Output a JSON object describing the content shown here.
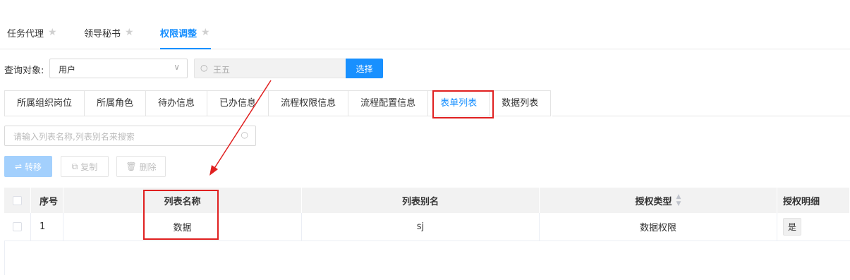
{
  "top_tabs": [
    {
      "label": "任务代理",
      "active": false
    },
    {
      "label": "领导秘书",
      "active": false
    },
    {
      "label": "权限调整",
      "active": true
    }
  ],
  "query": {
    "label": "查询对象:",
    "object_type": "用户",
    "search_placeholder": "王五",
    "select_button": "选择"
  },
  "sub_tabs": [
    {
      "label": "所属组织岗位",
      "active": false
    },
    {
      "label": "所属角色",
      "active": false
    },
    {
      "label": "待办信息",
      "active": false
    },
    {
      "label": "已办信息",
      "active": false
    },
    {
      "label": "流程权限信息",
      "active": false
    },
    {
      "label": "流程配置信息",
      "active": false
    },
    {
      "label": "表单列表",
      "active": true
    },
    {
      "label": "数据列表",
      "active": false
    }
  ],
  "list_search": {
    "placeholder": "请输入列表名称,列表别名来搜索"
  },
  "actions": {
    "move": "转移",
    "copy": "复制",
    "delete": "删除"
  },
  "table": {
    "columns": [
      "序号",
      "列表名称",
      "列表别名",
      "授权类型",
      "授权明细"
    ],
    "rows": [
      {
        "no": "1",
        "name": "数据",
        "alias": "sj",
        "auth_type": "数据权限",
        "detail": "是"
      }
    ]
  },
  "colors": {
    "accent": "#1890ff",
    "highlight": "#e02020"
  }
}
